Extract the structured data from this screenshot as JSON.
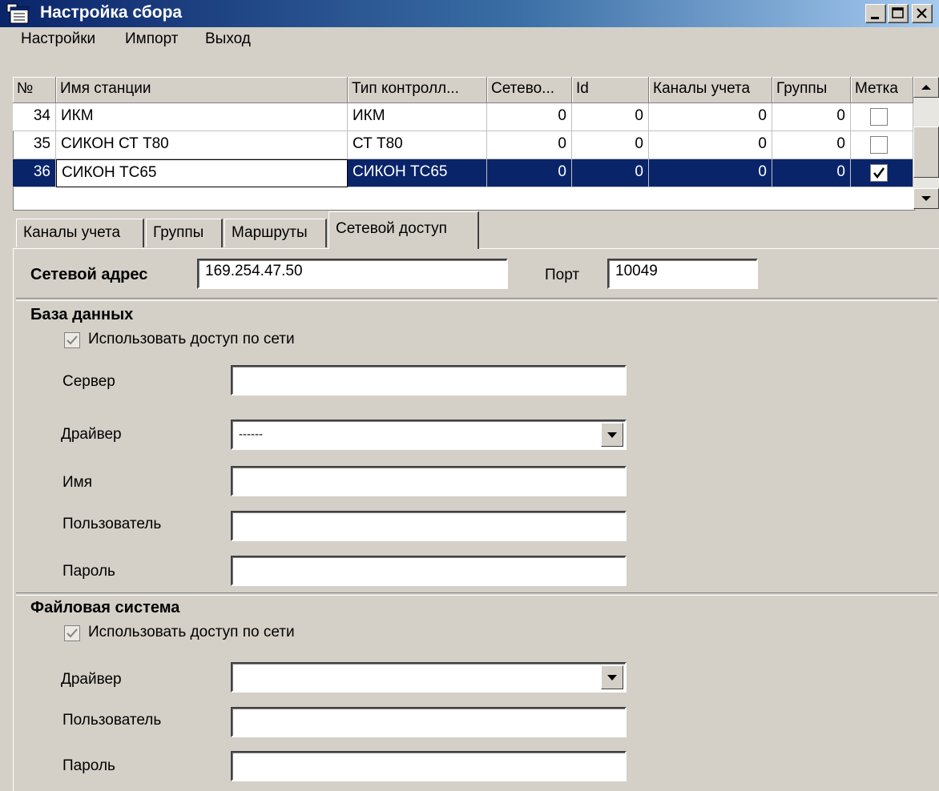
{
  "window": {
    "title": "Настройка сбора"
  },
  "menu": {
    "items": [
      "Настройки",
      "Импорт",
      "Выход"
    ]
  },
  "grid": {
    "columns": [
      "№",
      "Имя станции",
      "Тип контролл...",
      "Сетево...",
      "Id",
      "Каналы учета",
      "Группы",
      "Метка"
    ],
    "rows": [
      {
        "num": "34",
        "name": "ИКМ",
        "type": "ИКМ",
        "net": "0",
        "id": "0",
        "channels": "0",
        "groups": "0",
        "mark": false
      },
      {
        "num": "35",
        "name": "СИКОН СТ Т80",
        "type": "СТ Т80",
        "net": "0",
        "id": "0",
        "channels": "0",
        "groups": "0",
        "mark": false
      },
      {
        "num": "36",
        "name": "СИКОН ТС65",
        "type": "СИКОН ТС65",
        "net": "0",
        "id": "0",
        "channels": "0",
        "groups": "0",
        "mark": true
      }
    ],
    "selected_row": 2
  },
  "tabs": [
    "Каналы учета",
    "Группы",
    "Маршруты",
    "Сетевой доступ"
  ],
  "active_tab": 3,
  "network": {
    "address_label": "Сетевой адрес",
    "address_value": "169.254.47.50",
    "port_label": "Порт",
    "port_value": "10049"
  },
  "database": {
    "section_title": "База данных",
    "use_network_label": "Использовать доступ по сети",
    "use_network_checked": true,
    "server_label": "Сервер",
    "server_value": "",
    "driver_label": "Драйвер",
    "driver_value": "------",
    "name_label": "Имя",
    "name_value": "",
    "user_label": "Пользователь",
    "user_value": "",
    "password_label": "Пароль",
    "password_value": ""
  },
  "filesystem": {
    "section_title": "Файловая система",
    "use_network_label": "Использовать доступ по сети",
    "use_network_checked": true,
    "driver_label": "Драйвер",
    "driver_value": "",
    "user_label": "Пользователь",
    "user_value": "",
    "password_label": "Пароль",
    "password_value": ""
  },
  "colors": {
    "selection": "#0a246a",
    "window_bg": "#d4d0c8",
    "title_start": "#0a246a",
    "title_end": "#a6caf0"
  }
}
